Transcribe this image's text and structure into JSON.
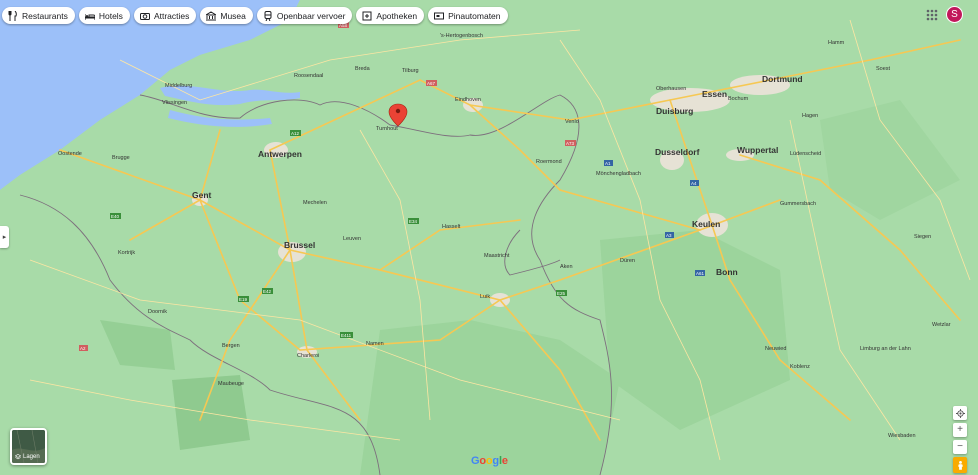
{
  "chips": [
    {
      "label": "Restaurants",
      "icon": "fork-knife-icon"
    },
    {
      "label": "Hotels",
      "icon": "bed-icon"
    },
    {
      "label": "Attracties",
      "icon": "camera-icon"
    },
    {
      "label": "Musea",
      "icon": "museum-icon"
    },
    {
      "label": "Openbaar vervoer",
      "icon": "train-icon"
    },
    {
      "label": "Apotheken",
      "icon": "pharmacy-icon"
    },
    {
      "label": "Pinautomaten",
      "icon": "cash-icon"
    }
  ],
  "account": {
    "initial": "S"
  },
  "layers": {
    "label": "Lagen"
  },
  "brand": {
    "letters": [
      "G",
      "o",
      "o",
      "g",
      "l",
      "e"
    ]
  },
  "cities_major": [
    {
      "name": "Antwerpen"
    },
    {
      "name": "Gent"
    },
    {
      "name": "Brussel"
    },
    {
      "name": "Essen"
    },
    {
      "name": "Dortmund"
    },
    {
      "name": "Duisburg"
    },
    {
      "name": "Dusseldorf"
    },
    {
      "name": "Wuppertal"
    },
    {
      "name": "Keulen"
    },
    {
      "name": "Bonn"
    }
  ],
  "cities_minor": [
    {
      "name": "Middelburg"
    },
    {
      "name": "Roosendaal"
    },
    {
      "name": "Breda"
    },
    {
      "name": "Tilburg"
    },
    {
      "name": "'s-Hertogenbosch"
    },
    {
      "name": "Eindhoven"
    },
    {
      "name": "Venlo"
    },
    {
      "name": "Roermond"
    },
    {
      "name": "Oberhausen"
    },
    {
      "name": "Bochum"
    },
    {
      "name": "Hamm"
    },
    {
      "name": "Soest"
    },
    {
      "name": "Hagen"
    },
    {
      "name": "Lüdenscheid"
    },
    {
      "name": "Gummersbach"
    },
    {
      "name": "Mönchengladbach"
    },
    {
      "name": "Hasselt"
    },
    {
      "name": "Maastricht"
    },
    {
      "name": "Aken"
    },
    {
      "name": "Düren"
    },
    {
      "name": "Leuven"
    },
    {
      "name": "Mechelen"
    },
    {
      "name": "Brugge"
    },
    {
      "name": "Oostende"
    },
    {
      "name": "Kortrijk"
    },
    {
      "name": "Doornik"
    },
    {
      "name": "Bergen"
    },
    {
      "name": "Charleroi"
    },
    {
      "name": "Namen"
    },
    {
      "name": "Luik"
    },
    {
      "name": "Koblenz"
    },
    {
      "name": "Neuwied"
    },
    {
      "name": "Turnhout"
    },
    {
      "name": "Maubeuge"
    },
    {
      "name": "Wiesbaden"
    },
    {
      "name": "Vlissingen"
    },
    {
      "name": "Siegen"
    },
    {
      "name": "Limburg an der Lahn"
    },
    {
      "name": "Wetzlar"
    }
  ],
  "road_shields": [
    {
      "ref": "A58"
    },
    {
      "ref": "A67"
    },
    {
      "ref": "A73"
    },
    {
      "ref": "E34"
    },
    {
      "ref": "A12"
    },
    {
      "ref": "E40"
    },
    {
      "ref": "E19"
    },
    {
      "ref": "E42"
    },
    {
      "ref": "E411"
    },
    {
      "ref": "A4"
    },
    {
      "ref": "A1"
    },
    {
      "ref": "A3"
    },
    {
      "ref": "E25"
    },
    {
      "ref": "A61"
    },
    {
      "ref": "A2"
    }
  ]
}
